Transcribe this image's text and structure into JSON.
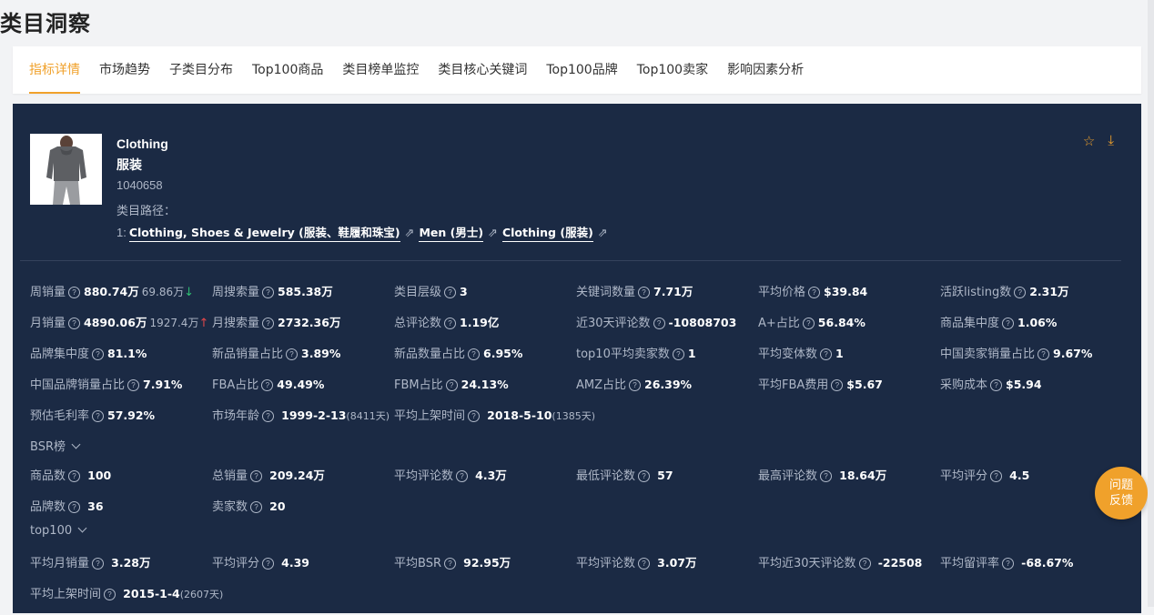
{
  "page_title": "类目洞察",
  "tabs": [
    "指标详情",
    "市场趋势",
    "子类目分布",
    "Top100商品",
    "类目榜单监控",
    "类目核心关键词",
    "Top100品牌",
    "Top100卖家",
    "影响因素分析"
  ],
  "active_tab": 0,
  "category": {
    "name_en": "Clothing",
    "name_zh": "服装",
    "id": "1040658",
    "path_label": "类目路径：",
    "path_prefix": "1:",
    "path": [
      "Clothing, Shoes & Jewelry (服装、鞋履和珠宝)",
      "Men (男士)",
      "Clothing (服装)"
    ]
  },
  "icons": {
    "favorite": "star-icon",
    "download": "download-icon",
    "help": "question-circle-icon",
    "share": "share-arrow-icon"
  },
  "colors": {
    "accent": "#f0a12b",
    "panel_bg": "#1b2a44",
    "up": "#e0474a",
    "down": "#2dbd72"
  },
  "metrics": {
    "weekly_sales": {
      "label": "周销量",
      "value": "880.74万",
      "change": "69.86万",
      "trend": "↓"
    },
    "weekly_search": {
      "label": "周搜索量",
      "value": "585.38万"
    },
    "level": {
      "label": "类目层级",
      "value": "3"
    },
    "keyword_count": {
      "label": "关键词数量",
      "value": "7.71万"
    },
    "avg_price": {
      "label": "平均价格",
      "value": "$39.84"
    },
    "active_listing": {
      "label": "活跃listing数",
      "value": "2.31万"
    },
    "monthly_sales": {
      "label": "月销量",
      "value": "4890.06万",
      "change": "1927.4万",
      "trend": "↑"
    },
    "monthly_search": {
      "label": "月搜索量",
      "value": "2732.36万"
    },
    "total_reviews": {
      "label": "总评论数",
      "value": "1.19亿"
    },
    "reviews_30d": {
      "label": "近30天评论数",
      "value": "-10808703"
    },
    "aplus_ratio": {
      "label": "A+占比",
      "value": "56.84%"
    },
    "product_concentration": {
      "label": "商品集中度",
      "value": "1.06%"
    },
    "brand_concentration": {
      "label": "品牌集中度",
      "value": "81.1%"
    },
    "new_sales_ratio": {
      "label": "新品销量占比",
      "value": "3.89%"
    },
    "new_count_ratio": {
      "label": "新品数量占比",
      "value": "6.95%"
    },
    "top10_sellers": {
      "label": "top10平均卖家数",
      "value": "1"
    },
    "avg_variants": {
      "label": "平均变体数",
      "value": "1"
    },
    "cn_seller_sales": {
      "label": "中国卖家销量占比",
      "value": "9.67%"
    },
    "cn_brand_sales": {
      "label": "中国品牌销量占比",
      "value": "7.91%"
    },
    "fba_ratio": {
      "label": "FBA占比",
      "value": "49.49%"
    },
    "fbm_ratio": {
      "label": "FBM占比",
      "value": "24.13%"
    },
    "amz_ratio": {
      "label": "AMZ占比",
      "value": "26.39%"
    },
    "avg_fba_fee": {
      "label": "平均FBA费用",
      "value": "$5.67"
    },
    "purchase_cost": {
      "label": "采购成本",
      "value": "$5.94"
    },
    "gross_margin": {
      "label": "预估毛利率",
      "value": "57.92%"
    },
    "market_age": {
      "label": "市场年龄",
      "value": "1999-2-13",
      "days": "(8411天)"
    },
    "avg_listing_time": {
      "label": "平均上架时间",
      "value": "2018-5-10",
      "days": "(1385天)"
    }
  },
  "bsr": {
    "title": "BSR榜",
    "product_count": {
      "label": "商品数",
      "value": "100"
    },
    "total_sales": {
      "label": "总销量",
      "value": "209.24万"
    },
    "avg_reviews": {
      "label": "平均评论数",
      "value": "4.3万"
    },
    "min_reviews": {
      "label": "最低评论数",
      "value": "57"
    },
    "max_reviews": {
      "label": "最高评论数",
      "value": "18.64万"
    },
    "avg_rating": {
      "label": "平均评分",
      "value": "4.5"
    },
    "brand_count": {
      "label": "品牌数",
      "value": "36"
    },
    "seller_count": {
      "label": "卖家数",
      "value": "20"
    }
  },
  "top100": {
    "title": "top100",
    "avg_monthly_sales": {
      "label": "平均月销量",
      "value": "3.28万"
    },
    "avg_rating": {
      "label": "平均评分",
      "value": "4.39"
    },
    "avg_bsr": {
      "label": "平均BSR",
      "value": "92.95万"
    },
    "avg_reviews": {
      "label": "平均评论数",
      "value": "3.07万"
    },
    "avg_reviews_30d": {
      "label": "平均近30天评论数",
      "value": "-22508"
    },
    "avg_retention": {
      "label": "平均留评率",
      "value": "-68.67%"
    },
    "avg_listing_time": {
      "label": "平均上架时间",
      "value": "2015-1-4",
      "days": "(2607天)"
    }
  },
  "feedback_button": {
    "line1": "问题",
    "line2": "反馈"
  }
}
